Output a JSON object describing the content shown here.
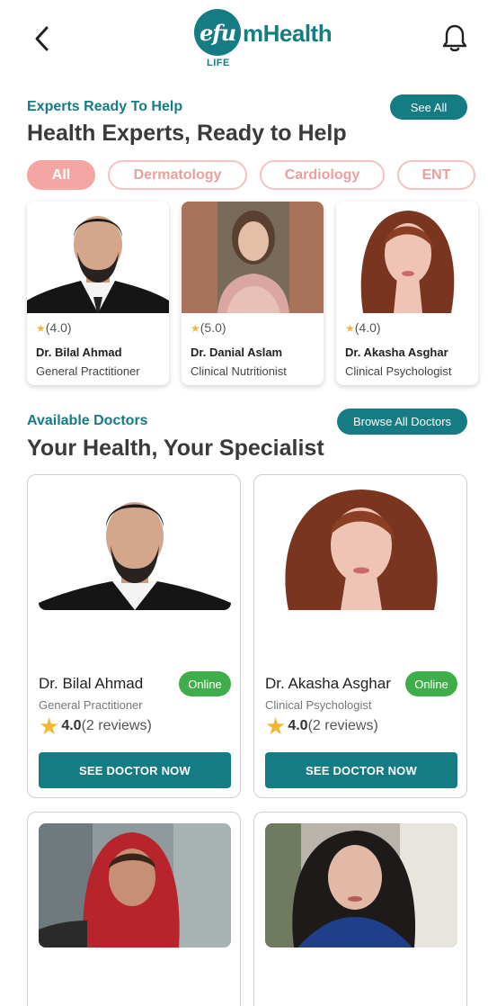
{
  "header": {
    "logo_mark": "efu",
    "logo_word": "mHealth",
    "logo_sub": "LIFE"
  },
  "experts_section": {
    "eyebrow": "Experts Ready To Help",
    "title": "Health Experts, Ready to Help",
    "see_all_label": "See All",
    "filters": [
      "All",
      "Dermatology",
      "Cardiology",
      "ENT"
    ],
    "active_filter": "All",
    "cards": [
      {
        "rating": "(4.0)",
        "name": "Dr. Bilal Ahmad",
        "specialty": "General Practitioner"
      },
      {
        "rating": "(5.0)",
        "name": "Dr. Danial Aslam",
        "specialty": "Clinical Nutritionist"
      },
      {
        "rating": "(4.0)",
        "name": "Dr. Akasha Asghar",
        "specialty": "Clinical Psychologist"
      }
    ]
  },
  "doctors_section": {
    "eyebrow": "Available Doctors",
    "title": "Your Health, Your Specialist",
    "browse_label": "Browse All Doctors",
    "cards": [
      {
        "name": "Dr. Bilal Ahmad",
        "status": "Online",
        "specialty": "General Practitioner",
        "rating": "4.0",
        "reviews": "(2 reviews)",
        "cta": "SEE DOCTOR NOW"
      },
      {
        "name": "Dr. Akasha Asghar",
        "status": "Online",
        "specialty": "Clinical Psychologist",
        "rating": "4.0",
        "reviews": "(2 reviews)",
        "cta": "SEE DOCTOR NOW"
      }
    ]
  },
  "colors": {
    "brand": "#157c83",
    "chip_active": "#f4a6a4",
    "online": "#3fae4a",
    "star": "#f2b632"
  }
}
